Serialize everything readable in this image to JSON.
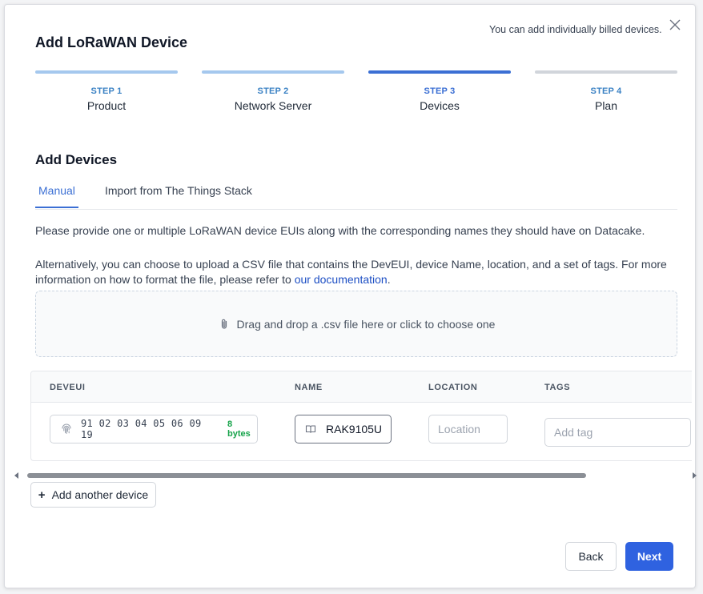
{
  "modal": {
    "top_note": "You can add individually billed devices.",
    "title": "Add LoRaWAN Device"
  },
  "steps": [
    {
      "num": "STEP 1",
      "label": "Product",
      "state": "done"
    },
    {
      "num": "STEP 2",
      "label": "Network Server",
      "state": "done"
    },
    {
      "num": "STEP 3",
      "label": "Devices",
      "state": "active"
    },
    {
      "num": "STEP 4",
      "label": "Plan",
      "state": "pending"
    }
  ],
  "section_title": "Add Devices",
  "tabs": {
    "manual": "Manual",
    "import": "Import from The Things Stack"
  },
  "paragraphs": {
    "p1": "Please provide one or multiple LoRaWAN device EUIs along with the corresponding names they should have on Datacake.",
    "p2_before": "Alternatively, you can choose to upload a CSV file that contains the DevEUI, device Name, location, and a set of tags. For more information on how to format the file, please refer to ",
    "p2_link": "our documentation",
    "p2_after": "."
  },
  "dropzone": {
    "text": "Drag and drop a .csv file here or click to choose one",
    "icon": "paperclip-icon"
  },
  "table": {
    "headers": {
      "deveui": "DEVEUI",
      "name": "NAME",
      "location": "LOCATION",
      "tags": "TAGS"
    },
    "row": {
      "deveui": "91 02 03 04 05 06 09 19",
      "deveui_bytes": "8 bytes",
      "name": "RAK9105U",
      "location_placeholder": "Location",
      "tags_placeholder": "Add tag"
    }
  },
  "buttons": {
    "add_device_plus": "+",
    "add_device": "Add another device",
    "back": "Back",
    "next": "Next"
  },
  "colors": {
    "primary": "#2f62e0",
    "link": "#1d4fc4",
    "success": "#16a34a"
  }
}
